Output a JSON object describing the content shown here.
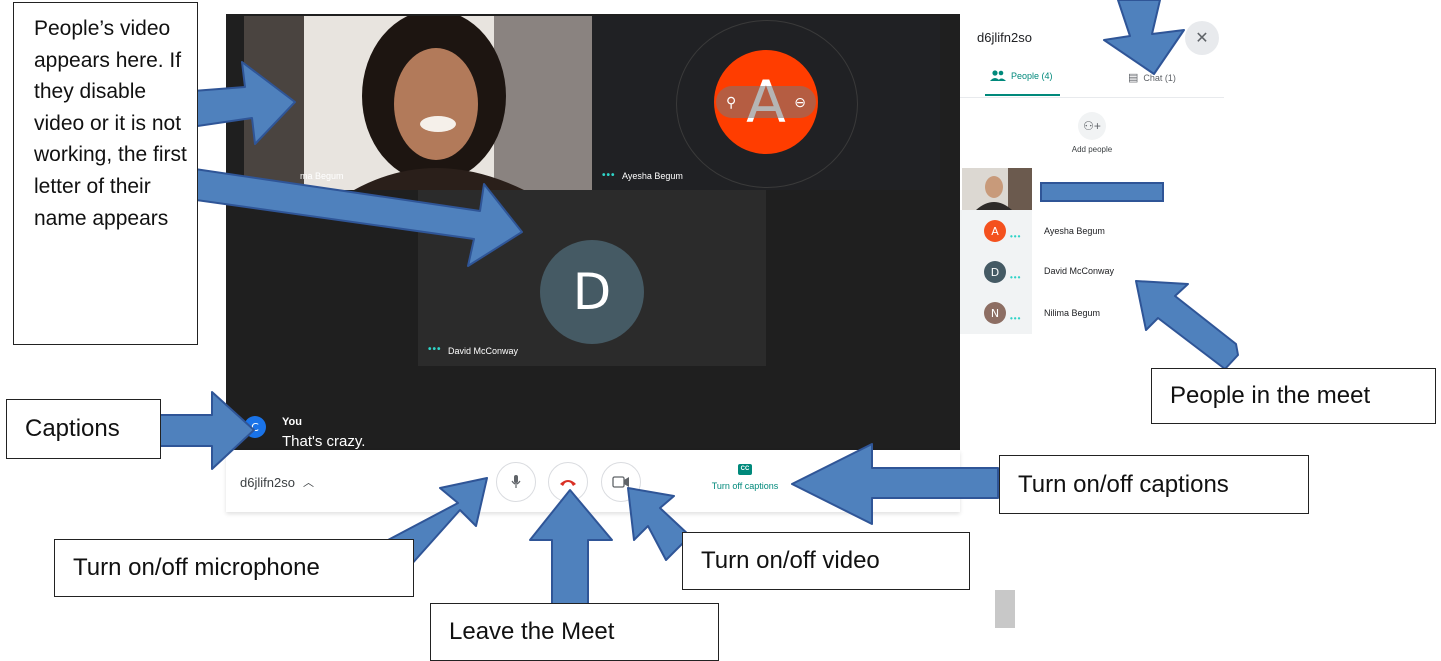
{
  "meeting": {
    "code": "d6jlifn2so",
    "panel_code": "d6jlifn2so"
  },
  "tiles": [
    {
      "name": "ma Begum"
    },
    {
      "name": "Ayesha Begum",
      "initial": "A"
    },
    {
      "name": "David McConway",
      "initial": "D"
    }
  ],
  "captions": {
    "speaker": "You",
    "speaker_initial": "C",
    "text": "That's crazy."
  },
  "toolbar": {
    "captions_icon": "CC",
    "captions_label": "Turn off captions"
  },
  "panel": {
    "people_tab": "People (4)",
    "chat_tab": "Chat (1)",
    "add_people": "Add people",
    "participants": [
      {
        "initial": "A",
        "name": "Ayesha Begum",
        "color": "#f4511e"
      },
      {
        "initial": "D",
        "name": "David McConway",
        "color": "#455a64"
      },
      {
        "initial": "N",
        "name": "Nilima Begum",
        "color": "#8d6e63"
      }
    ]
  },
  "callouts": {
    "video": "People’s video appears here. If they disable video or it is not working, the first letter of their name appears",
    "captions": "Captions",
    "people": "People in the meet",
    "toggle_captions": "Turn on/off captions",
    "microphone": "Turn on/off microphone",
    "video_toggle": "Turn on/off video",
    "leave": "Leave the Meet"
  },
  "colors": {
    "accent_teal": "#00897b",
    "arrow_fill": "#4f81bd",
    "arrow_stroke": "#2f5597",
    "end_call_red": "#d93025",
    "orange_avatar": "#ff3d00"
  }
}
